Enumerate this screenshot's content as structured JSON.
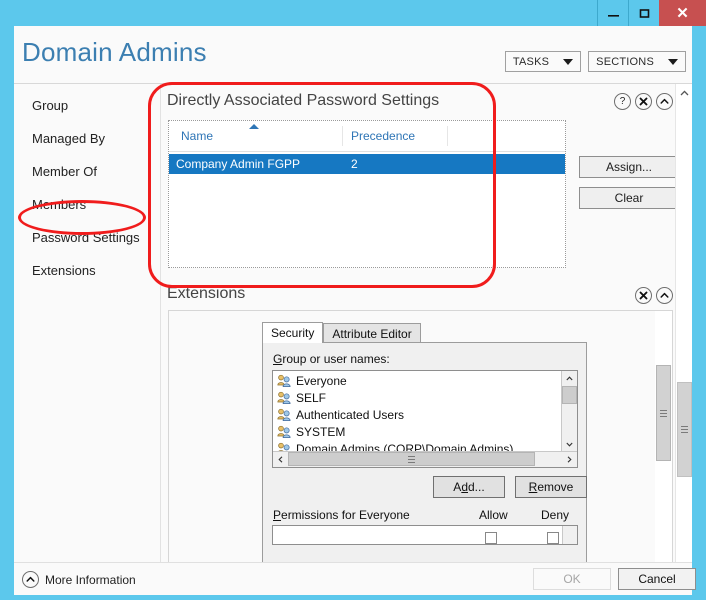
{
  "window": {
    "chrome_color": "#5CC8EC",
    "close_color": "#C75050",
    "buttons": {
      "minimize": "minimize",
      "maximize": "maximize",
      "close": "x"
    }
  },
  "header": {
    "title": "Domain Admins",
    "tasks_label": "TASKS",
    "sections_label": "SECTIONS"
  },
  "nav": {
    "items": [
      {
        "label": "Group"
      },
      {
        "label": "Managed By"
      },
      {
        "label": "Member Of"
      },
      {
        "label": "Members"
      },
      {
        "label": "Password Settings"
      },
      {
        "label": "Extensions"
      }
    ],
    "selected": "Password Settings"
  },
  "password_settings": {
    "section_title": "Directly Associated Password Settings",
    "icons": [
      "help-icon",
      "close-icon",
      "collapse-icon"
    ],
    "columns": [
      "Name",
      "Precedence"
    ],
    "sort_column": "Name",
    "sort_direction": "ascending",
    "rows": [
      {
        "name": "Company Admin FGPP",
        "precedence": "2",
        "selected": true
      }
    ],
    "buttons": {
      "assign": "Assign...",
      "clear": "Clear"
    }
  },
  "extensions": {
    "section_title": "Extensions",
    "icons": [
      "close-icon",
      "collapse-icon"
    ],
    "tabs": [
      {
        "label": "Security",
        "active": true
      },
      {
        "label": "Attribute Editor",
        "active": false
      }
    ],
    "security": {
      "group_label_prefix": "G",
      "group_label_rest": "roup or user names:",
      "principals": [
        "Everyone",
        "SELF",
        "Authenticated Users",
        "SYSTEM",
        "Domain Admins (CORP\\Domain Admins)"
      ],
      "add_button_prefix": "A",
      "add_button_mnemonic": "d",
      "add_button_suffix": "d...",
      "remove_button_mnemonic": "R",
      "remove_button_suffix": "emove",
      "permissions_label_mnemonic": "P",
      "permissions_label_rest": "ermissions for Everyone",
      "allow_label": "Allow",
      "deny_label": "Deny"
    }
  },
  "footer": {
    "more_information": "More Information",
    "ok_label": "OK",
    "ok_enabled": false,
    "cancel_label": "Cancel",
    "cancel_enabled": true
  },
  "annotations": {
    "color": "#F01C1C",
    "shapes": [
      {
        "name": "password-settings-nav-highlight",
        "shape": "oval"
      },
      {
        "name": "directly-associated-password-settings-highlight",
        "shape": "rect"
      }
    ]
  }
}
